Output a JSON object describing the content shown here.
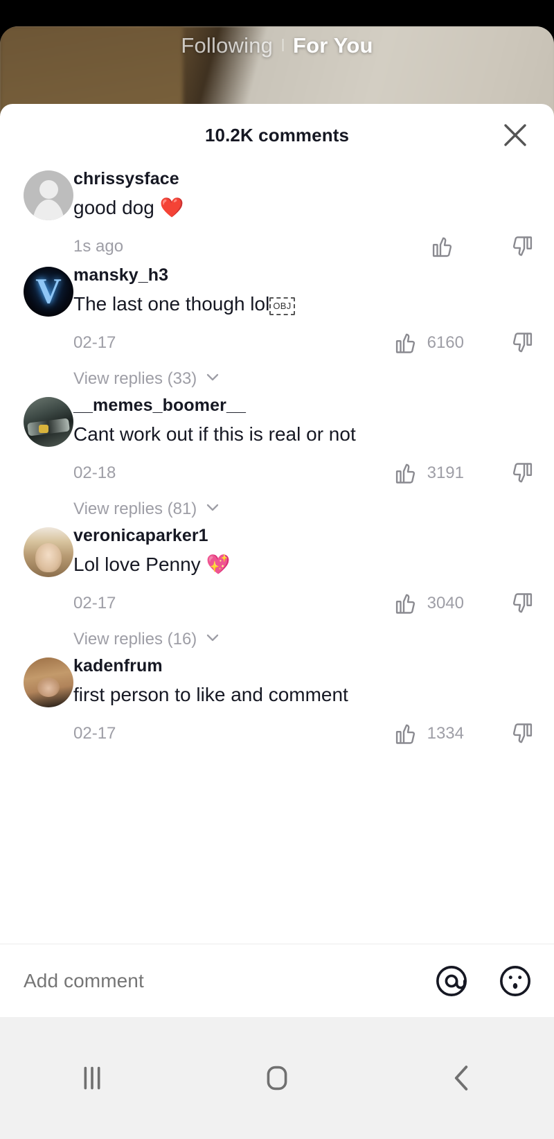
{
  "feed": {
    "tabs": [
      {
        "label": "Following",
        "active": false
      },
      {
        "label": "For You",
        "active": true
      }
    ],
    "separator": "|"
  },
  "comments_sheet": {
    "title": "10.2K comments",
    "close_icon": "close-icon",
    "comments": [
      {
        "username": "chrissysface",
        "text": "good dog ",
        "emoji": "❤️",
        "date": "1s ago",
        "likes": "",
        "avatar": "default-person",
        "replies": null
      },
      {
        "username": "mansky_h3",
        "text": "The last one though lol",
        "emoji": "",
        "obj_glyph": "OBJ",
        "date": "02-17",
        "likes": "6160",
        "avatar": "vlone-v-logo",
        "replies": "View replies (33)"
      },
      {
        "username": "__memes_boomer__",
        "text": "Cant work out if this is real or not",
        "emoji": "",
        "date": "02-18",
        "likes": "3191",
        "avatar": "f1-race-car",
        "replies": "View replies (81)"
      },
      {
        "username": "veronicaparker1",
        "text": "Lol love Penny ",
        "emoji": "💖",
        "date": "02-17",
        "likes": "3040",
        "avatar": "woman-selfie",
        "replies": "View replies (16)"
      },
      {
        "username": "kadenfrum",
        "text": "first person to like and comment",
        "emoji": "",
        "date": "02-17",
        "likes": "1334",
        "avatar": "tan-photo",
        "replies": null
      }
    ]
  },
  "input_bar": {
    "placeholder": "Add comment",
    "mention_icon": "at-mention-icon",
    "emoji_icon": "emoji-face-icon"
  },
  "navbar": {
    "recents_label": "recents-icon",
    "home_label": "home-icon",
    "back_label": "back-icon"
  },
  "colors": {
    "sheet_bg": "#ffffff",
    "primary_text": "#161823",
    "muted_text": "#9e9ea6",
    "placeholder": "#b0b0b6",
    "navbar_bg": "#f1f1f1",
    "divider": "#ececec"
  }
}
